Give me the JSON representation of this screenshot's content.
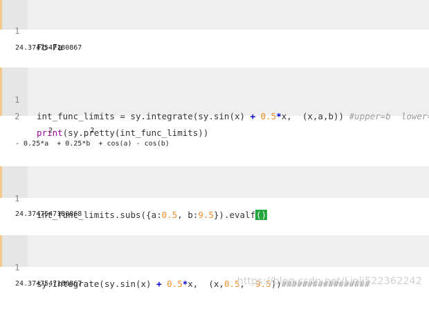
{
  "cells": [
    {
      "lines": [
        {
          "number": "1",
          "tokens": [
            "Fb-Fa"
          ]
        }
      ],
      "output": "24.3747547180867"
    },
    {
      "lines": [
        {
          "number": "1",
          "tokens": [
            "int_func_limits = sy.integrate(sy.sin(x) ",
            "+",
            " ",
            "0.5",
            "*",
            "x,  (x,a,b)) ",
            "#upper=b  lower=a"
          ]
        },
        {
          "number": "2",
          "tokens": [
            "print",
            "(sy.pretty(int_func_limits))"
          ]
        }
      ],
      "output_lines": [
        "        2         2",
        "- 0.25*a  + 0.25*b  + cos(a) - cos(b)"
      ]
    },
    {
      "lines": [
        {
          "number": "1",
          "tokens": [
            "int_func_limits.subs({a:",
            "0.5",
            ", b:",
            "9.5",
            "}).evalf",
            "()"
          ]
        }
      ],
      "output": "24.3747547180868"
    },
    {
      "lines": [
        {
          "number": "1",
          "tokens": [
            "sy.integrate(sy.sin(x) ",
            "+",
            " ",
            "0.5",
            "*",
            "x,  (x,",
            "0.5",
            ",  ",
            "9.5",
            "))",
            "#################"
          ]
        }
      ],
      "output": "24.3747547180867"
    }
  ],
  "watermark": "https://blog.csdn.net/Linli522362242",
  "colors": {
    "cell_bg": "#efefef",
    "gutter_bg": "#e6e6e6",
    "cell_border": "#f3c98b",
    "operator": "#0000cc",
    "number": "#f08c2a",
    "keyword": "#990099",
    "comment": "#9a9a9a",
    "cursor_highlight": "#22a63d"
  }
}
